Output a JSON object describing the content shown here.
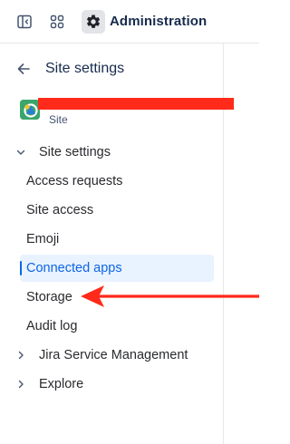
{
  "topbar": {
    "title": "Administration",
    "sidebar_toggle_icon": "sidebar-toggle-icon",
    "app_switcher_icon": "app-switcher-icon",
    "admin_icon": "gear-icon"
  },
  "sidebar": {
    "back_icon": "arrow-left-icon",
    "heading": "Site settings",
    "site": {
      "type_label": "Site",
      "logo_color": "#3aa66b"
    },
    "groups": [
      {
        "label": "Site settings",
        "expanded": true
      },
      {
        "label": "Jira Service Management",
        "expanded": false
      },
      {
        "label": "Explore",
        "expanded": false
      }
    ],
    "items": [
      {
        "label": "Access requests"
      },
      {
        "label": "Site access"
      },
      {
        "label": "Emoji"
      },
      {
        "label": "Connected apps",
        "selected": true
      },
      {
        "label": "Storage"
      },
      {
        "label": "Audit log"
      }
    ]
  },
  "colors": {
    "selected_text": "#0c66e4",
    "selected_bg": "#e9f2ff",
    "annotation": "#ff2a1a"
  }
}
